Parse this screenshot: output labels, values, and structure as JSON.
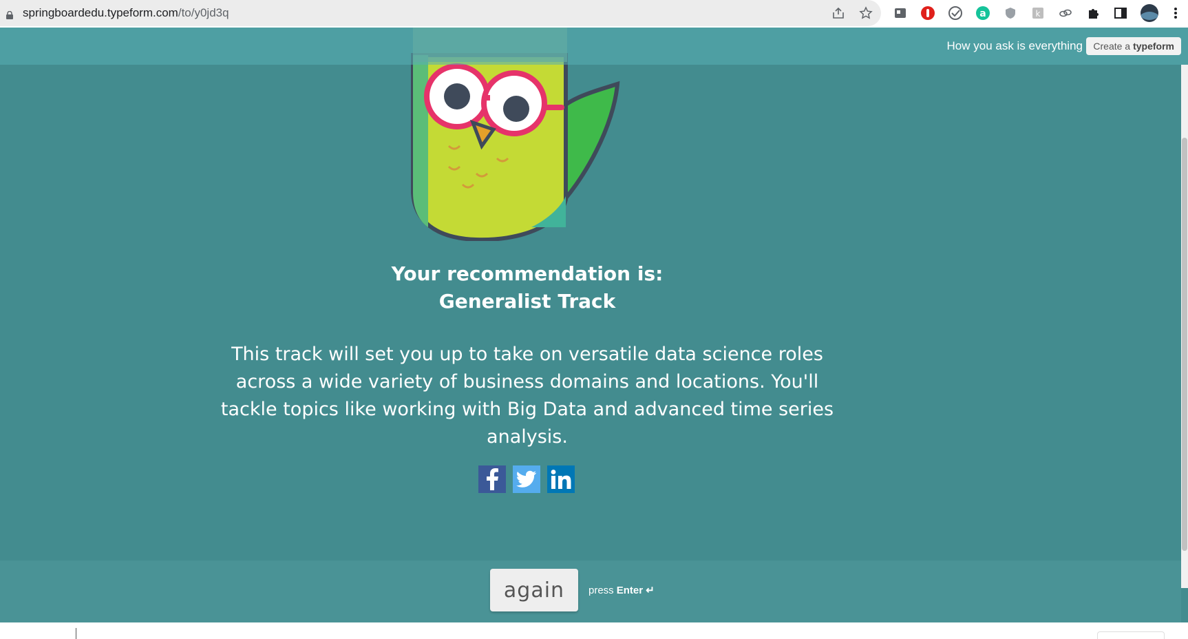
{
  "browser": {
    "url_host": "springboardedu.typeform.com",
    "url_path": "/to/y0jd3q"
  },
  "topbar": {
    "tagline": "How you ask is everything",
    "create_prefix": "Create a",
    "create_brand": "typeform"
  },
  "result": {
    "heading_line1": "Your recommendation is:",
    "heading_line2": "Generalist Track",
    "description": "This track will set you up to take on versatile data science roles across a wide variety of business domains and locations. You'll tackle topics like working with Big Data and advanced time series analysis."
  },
  "social": [
    "facebook-icon",
    "twitter-icon",
    "linkedin-icon"
  ],
  "footer": {
    "again_label": "again",
    "press_label": "press",
    "enter_label": "Enter ↵"
  },
  "colors": {
    "page_bg": "#438c8f",
    "facebook": "#3b5998",
    "twitter": "#55acee",
    "linkedin": "#0077b5"
  }
}
